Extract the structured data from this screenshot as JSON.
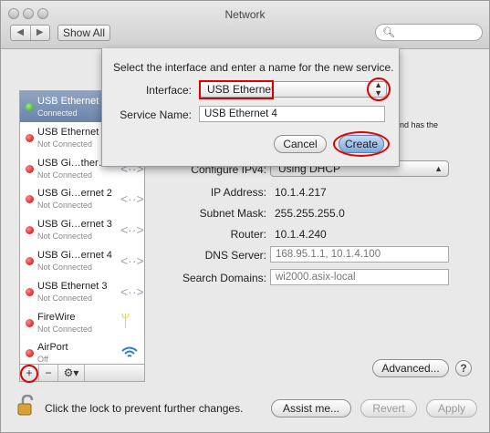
{
  "window": {
    "title": "Network"
  },
  "toolbar": {
    "back": "◀",
    "forward": "▶",
    "show_all": "Show All",
    "search_placeholder": ""
  },
  "services": [
    {
      "name": "USB Ethernet",
      "status": "Connected",
      "state": "green",
      "selected": true,
      "icon": ""
    },
    {
      "name": "USB Ethernet",
      "status": "Not Connected",
      "state": "red",
      "selected": false,
      "icon": ""
    },
    {
      "name": "USB Gi…ther…",
      "status": "Not Connected",
      "state": "red",
      "selected": false,
      "icon": "ethernet-arrows-icon"
    },
    {
      "name": "USB Gi…ernet 2",
      "status": "Not Connected",
      "state": "red",
      "selected": false,
      "icon": "ethernet-arrows-icon"
    },
    {
      "name": "USB Gi…ernet 3",
      "status": "Not Connected",
      "state": "red",
      "selected": false,
      "icon": "ethernet-arrows-icon"
    },
    {
      "name": "USB Gi…ernet 4",
      "status": "Not Connected",
      "state": "red",
      "selected": false,
      "icon": "ethernet-arrows-icon"
    },
    {
      "name": "USB Ethernet 3",
      "status": "Not Connected",
      "state": "red",
      "selected": false,
      "icon": "ethernet-arrows-icon"
    },
    {
      "name": "FireWire",
      "status": "Not Connected",
      "state": "red",
      "selected": false,
      "icon": "firewire-icon"
    },
    {
      "name": "AirPort",
      "status": "Off",
      "state": "red",
      "selected": false,
      "icon": "wifi-icon"
    }
  ],
  "sidebar_tools": {
    "add": "+",
    "remove": "−",
    "gear": "⚙▾"
  },
  "details": {
    "status_fragment": "nd has the",
    "configure_label": "Configure IPv4:",
    "configure_value": "Using DHCP",
    "ip_label": "IP Address:",
    "ip_value": "10.1.4.217",
    "subnet_label": "Subnet Mask:",
    "subnet_value": "255.255.255.0",
    "router_label": "Router:",
    "router_value": "10.1.4.240",
    "dns_label": "DNS Server:",
    "dns_value": "168.95.1.1, 10.1.4.100",
    "search_label": "Search Domains:",
    "search_value": "wi2000.asix-local"
  },
  "buttons": {
    "advanced": "Advanced...",
    "help": "?",
    "assist": "Assist me...",
    "revert": "Revert",
    "apply": "Apply"
  },
  "lock": {
    "message": "Click the lock to prevent further changes."
  },
  "sheet": {
    "message": "Select the interface and enter a name for the new service.",
    "interface_label": "Interface:",
    "interface_value": "USB Ethernet",
    "service_name_label": "Service Name:",
    "service_name_value": "USB Ethernet 4",
    "cancel": "Cancel",
    "create": "Create"
  },
  "colors": {
    "highlight": "#e00000",
    "selection": "#7b92b4"
  }
}
